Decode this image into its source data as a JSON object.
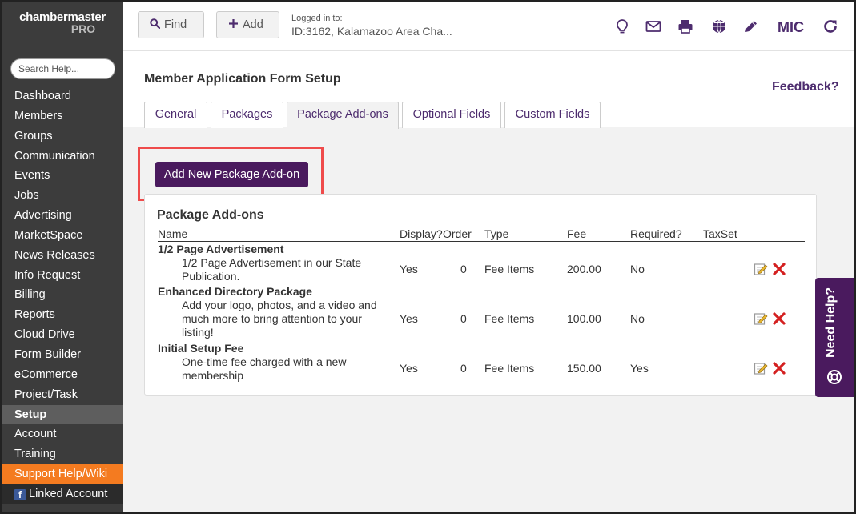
{
  "sidebar": {
    "logo_line1": "chambermaster",
    "logo_line2": "PRO",
    "search_placeholder": "Search Help...",
    "items": [
      {
        "label": "Dashboard",
        "name": "sidebar-item-dashboard"
      },
      {
        "label": "Members",
        "name": "sidebar-item-members"
      },
      {
        "label": "Groups",
        "name": "sidebar-item-groups"
      },
      {
        "label": "Communication",
        "name": "sidebar-item-communication"
      },
      {
        "label": "Events",
        "name": "sidebar-item-events"
      },
      {
        "label": "Jobs",
        "name": "sidebar-item-jobs"
      },
      {
        "label": "Advertising",
        "name": "sidebar-item-advertising"
      },
      {
        "label": "MarketSpace",
        "name": "sidebar-item-marketspace"
      },
      {
        "label": "News Releases",
        "name": "sidebar-item-news-releases"
      },
      {
        "label": "Info Request",
        "name": "sidebar-item-info-request"
      },
      {
        "label": "Billing",
        "name": "sidebar-item-billing"
      },
      {
        "label": "Reports",
        "name": "sidebar-item-reports"
      },
      {
        "label": "Cloud Drive",
        "name": "sidebar-item-cloud-drive"
      },
      {
        "label": "Form Builder",
        "name": "sidebar-item-form-builder"
      },
      {
        "label": "eCommerce",
        "name": "sidebar-item-ecommerce"
      },
      {
        "label": "Project/Task",
        "name": "sidebar-item-project-task"
      },
      {
        "label": "Setup",
        "name": "sidebar-item-setup",
        "active": true
      },
      {
        "label": "Account",
        "name": "sidebar-item-account"
      },
      {
        "label": "Training",
        "name": "sidebar-item-training"
      },
      {
        "label": "Support Help/Wiki",
        "name": "sidebar-item-support",
        "support": true
      }
    ],
    "linked_account": "Linked Account",
    "linked_icon": "facebook-icon"
  },
  "topbar": {
    "find_label": "Find",
    "add_label": "Add",
    "logged_label": "Logged in to:",
    "logged_value": "ID:3162, Kalamazoo Area Cha...",
    "icons": [
      "lightbulb-icon",
      "mail-icon",
      "printer-icon",
      "globe-icon",
      "pencil-icon"
    ],
    "user_initials": "MIC",
    "refresh_icon": "refresh-icon"
  },
  "page": {
    "title": "Member Application Form Setup",
    "feedback": "Feedback?",
    "tabs": [
      {
        "label": "General"
      },
      {
        "label": "Packages"
      },
      {
        "label": "Package Add-ons",
        "active": true
      },
      {
        "label": "Optional Fields"
      },
      {
        "label": "Custom Fields"
      }
    ],
    "add_button": "Add New Package Add-on"
  },
  "table": {
    "title": "Package Add-ons",
    "headers": {
      "name": "Name",
      "display": "Display?",
      "order": "Order",
      "type": "Type",
      "fee": "Fee",
      "required": "Required?",
      "taxset": "TaxSet"
    },
    "rows": [
      {
        "name": "1/2 Page Advertisement",
        "desc": "1/2 Page Advertisement in our State Publication.",
        "display": "Yes",
        "order": "0",
        "type": "Fee Items",
        "fee": "200.00",
        "required": "No",
        "taxset": ""
      },
      {
        "name": "Enhanced Directory Package",
        "desc": "Add your logo, photos, and a video and much more to bring attention to your listing!",
        "display": "Yes",
        "order": "0",
        "type": "Fee Items",
        "fee": "100.00",
        "required": "No",
        "taxset": ""
      },
      {
        "name": "Initial Setup Fee",
        "desc": "One-time fee charged with a new membership",
        "display": "Yes",
        "order": "0",
        "type": "Fee Items",
        "fee": "150.00",
        "required": "Yes",
        "taxset": ""
      }
    ]
  },
  "need_help": {
    "label": "Need Help?",
    "icon": "lifebuoy-icon"
  },
  "colors": {
    "brand_purple": "#4a1a5e",
    "accent_orange": "#f47b20",
    "highlight_red": "#ef4b4b",
    "sidebar_bg": "#3c3c3c"
  }
}
